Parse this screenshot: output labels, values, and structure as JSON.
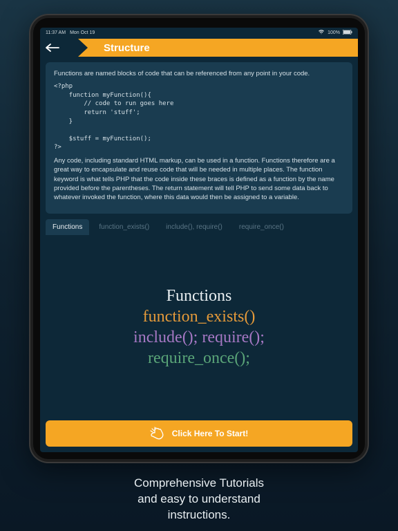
{
  "status": {
    "time": "11:37 AM",
    "date": "Mon Oct 19",
    "battery": "100%"
  },
  "header": {
    "title": "Structure"
  },
  "card": {
    "intro": "Functions are named blocks of code that can be referenced from any point in your code.",
    "code": "<?php\n    function myFunction(){\n        // code to run goes here\n        return 'stuff';\n    }\n\n    $stuff = myFunction();\n?>",
    "body": "Any code, including standard HTML markup, can be used in a function. Functions therefore are a great way to encapsulate and reuse code that will be needed in multiple places. The function keyword is what tells PHP that the code inside these braces is defined as a function by the name provided before the parentheses. The return statement will tell PHP to send some data back to whatever invoked the function, where this data would then be assigned to a variable."
  },
  "tabs": {
    "items": [
      {
        "label": "Functions",
        "active": true
      },
      {
        "label": "function_exists()",
        "active": false
      },
      {
        "label": "include(), require()",
        "active": false
      },
      {
        "label": "require_once()",
        "active": false
      }
    ]
  },
  "hero": {
    "line1": "Functions",
    "line2": "function_exists()",
    "line3": "include(); require();",
    "line4": "require_once();"
  },
  "cta": {
    "label": "Click Here To Start!"
  },
  "caption": {
    "line1": "Comprehensive Tutorials",
    "line2": "and easy to understand",
    "line3": "instructions."
  }
}
